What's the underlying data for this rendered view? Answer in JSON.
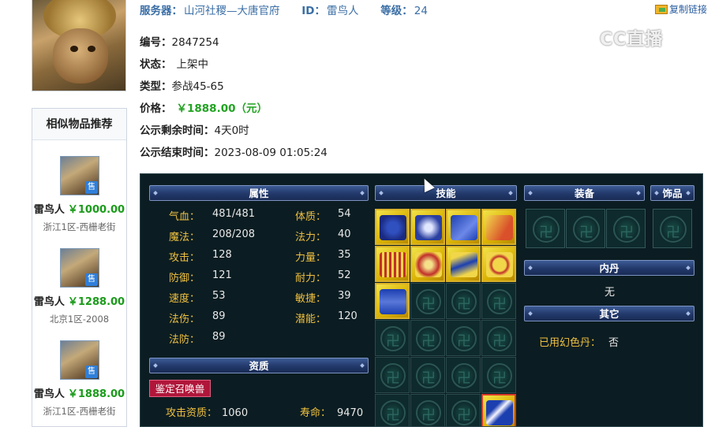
{
  "topbar": {
    "server_label": "服务器：",
    "server_value": "山河社稷—大唐官府",
    "id_label": "ID：",
    "id_value": "雷鸟人",
    "level_label": "等级：",
    "level_value": "24",
    "copy_link": "复制链接"
  },
  "watermark": "CC直播",
  "info": {
    "number_label": "编号：",
    "number_value": "2847254",
    "status_label": "状态：",
    "status_value": "上架中",
    "type_label": "类型：",
    "type_value": "参战45-65",
    "price_label": "价格：",
    "price_value": "￥1888.00（元）",
    "remain_label": "公示剩余时间：",
    "remain_value": "4天0时",
    "end_label": "公示结束时间：",
    "end_value": "2023-08-09 01:05:24"
  },
  "similar": {
    "title": "相似物品推荐",
    "badge": "售",
    "items": [
      {
        "name": "雷鸟人",
        "price": "￥1000.00",
        "server": "浙江1区-西栅老街"
      },
      {
        "name": "雷鸟人",
        "price": "￥1288.00",
        "server": "北京1区-2008"
      },
      {
        "name": "雷鸟人",
        "price": "￥1888.00",
        "server": "浙江1区-西栅老街"
      }
    ]
  },
  "panel": {
    "attr_title": "属性",
    "skill_title": "技能",
    "equip_title": "装备",
    "acc_title": "饰品",
    "neidan_title": "内丹",
    "neidan_value": "无",
    "other_title": "其它",
    "other_label": "已用幻色丹：",
    "other_value": "否",
    "aptitude_title": "资质",
    "appraise_button": "鉴定召唤兽",
    "attrs_left": [
      {
        "k": "气血：",
        "v": "481/481"
      },
      {
        "k": "魔法：",
        "v": "208/208"
      },
      {
        "k": "攻击：",
        "v": "128"
      },
      {
        "k": "防御：",
        "v": "121"
      },
      {
        "k": "速度：",
        "v": "53"
      },
      {
        "k": "法伤：",
        "v": "89"
      },
      {
        "k": "法防：",
        "v": "89"
      }
    ],
    "attrs_right": [
      {
        "k": "体质：",
        "v": "54"
      },
      {
        "k": "法力：",
        "v": "40"
      },
      {
        "k": "力量：",
        "v": "35"
      },
      {
        "k": "耐力：",
        "v": "52"
      },
      {
        "k": "敏捷：",
        "v": "39"
      },
      {
        "k": "潜能：",
        "v": "120"
      }
    ],
    "aptitude": {
      "attack_label": "攻击资质：",
      "attack_value": "1060",
      "life_label": "寿命：",
      "life_value": "9470"
    }
  }
}
